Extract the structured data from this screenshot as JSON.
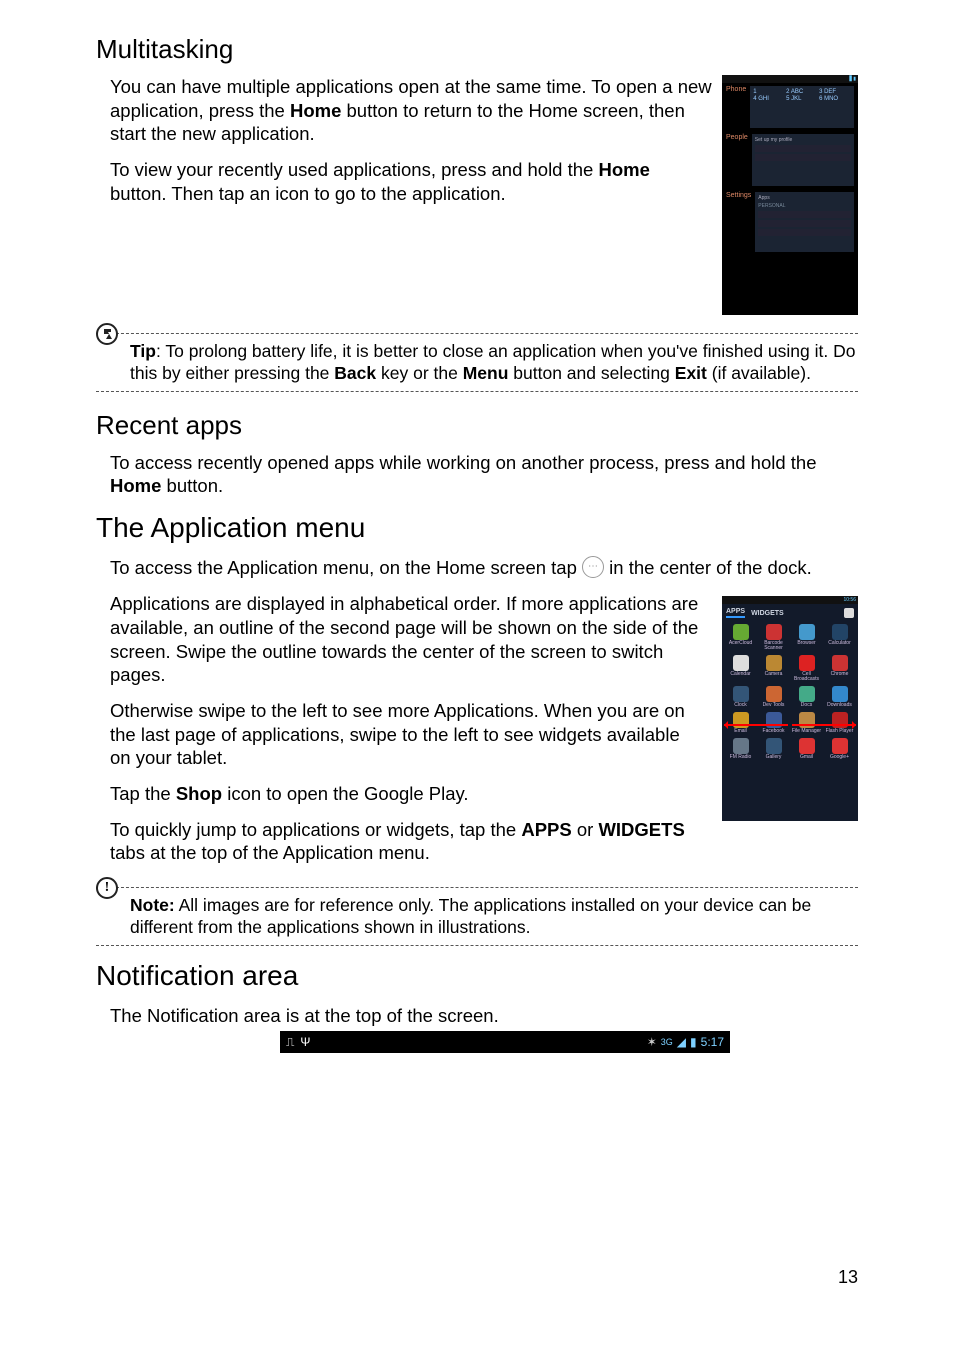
{
  "sections": {
    "multitasking": {
      "heading": "Multitasking",
      "p1a": "You can have multiple applications open at the same time. To open a new application, press the ",
      "p1b": "Home",
      "p1c": " button to return to the Home screen, then start the new application.",
      "p2a": "To view your recently used applications, press and hold the ",
      "p2b": "Home",
      "p2c": " button. Then tap an icon to go to the application."
    },
    "tip": {
      "label": "Tip",
      "t1": ": To prolong battery life, it is better to close an application when you've finished using it. Do this by either pressing the ",
      "t2": "Back",
      "t3": " key or the ",
      "t4": "Menu",
      "t5": " button and selecting ",
      "t6": "Exit",
      "t7": " (if available)."
    },
    "recent": {
      "heading": "Recent apps",
      "p1a": "To access recently opened apps while working on another process, press and hold the ",
      "p1b": "Home",
      "p1c": " button."
    },
    "appmenu": {
      "heading": "The Application menu",
      "p1a": "To access the Application menu, on the Home screen tap ",
      "p1b": " in the center of the dock.",
      "p2": "Applications are displayed in alphabetical order. If more applications are available, an outline of the second page will be shown on the side of the screen. Swipe the outline towards the center of the screen to switch pages.",
      "p3": "Otherwise swipe to the left to see more Applications. When you are on the last page of applications, swipe to the left to see widgets available on your tablet.",
      "p4a": "Tap the ",
      "p4b": "Shop",
      "p4c": " icon to open the Google Play.",
      "p5a": "To quickly jump to applications or widgets, tap the ",
      "p5b": "APPS",
      "p5c": " or ",
      "p5d": "WIDGETS",
      "p5e": " tabs at the top of the Application menu."
    },
    "note": {
      "label": "Note:",
      "text": " All images are for reference only. The applications installed on your device can be different from the applications shown in illustrations."
    },
    "notif": {
      "heading": "Notification area",
      "p1": "The Notification area is at the top of the screen."
    }
  },
  "thumb_recent": {
    "labels": [
      "Phone",
      "People",
      "Settings"
    ],
    "keypad": [
      "1",
      "2 ABC",
      "3 DEF",
      "4 GHI",
      "5 JKL",
      "6 MNO"
    ]
  },
  "thumb_apps": {
    "tabs": [
      "APPS",
      "WIDGETS"
    ],
    "apps": [
      {
        "name": "AcerCloud",
        "c": "#6a3"
      },
      {
        "name": "Barcode Scanner",
        "c": "#c33"
      },
      {
        "name": "Browser",
        "c": "#49c"
      },
      {
        "name": "Calculator",
        "c": "#246"
      },
      {
        "name": "Calendar",
        "c": "#ddd"
      },
      {
        "name": "Camera",
        "c": "#b83"
      },
      {
        "name": "Cell Broadcasts",
        "c": "#d22"
      },
      {
        "name": "Chrome",
        "c": "#c33"
      },
      {
        "name": "Clock",
        "c": "#357"
      },
      {
        "name": "Dev Tools",
        "c": "#c63"
      },
      {
        "name": "Docs",
        "c": "#4a8"
      },
      {
        "name": "Downloads",
        "c": "#38c"
      },
      {
        "name": "Email",
        "c": "#c92"
      },
      {
        "name": "Facebook",
        "c": "#3b5998"
      },
      {
        "name": "File Manager",
        "c": "#b84"
      },
      {
        "name": "Flash Player",
        "c": "#b22"
      },
      {
        "name": "FM Radio",
        "c": "#678"
      },
      {
        "name": "Gallery",
        "c": "#357"
      },
      {
        "name": "Gmail",
        "c": "#d33"
      },
      {
        "name": "Google+",
        "c": "#d33"
      }
    ],
    "clock": "10:56"
  },
  "statusbar": {
    "icons_left": [
      "usb-icon",
      "connection-icon"
    ],
    "signal": "3G",
    "battery_icon": "battery-icon",
    "time": "5:17"
  },
  "page_number": "13"
}
